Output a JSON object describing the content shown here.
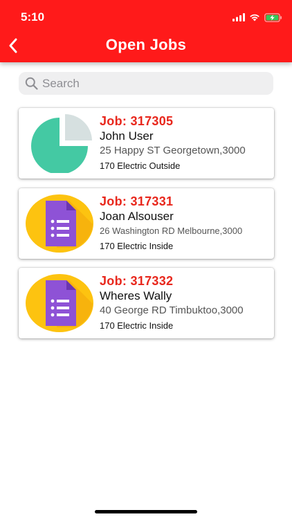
{
  "status_bar": {
    "time": "5:10",
    "icons": [
      "signal-icon",
      "wifi-icon",
      "battery-charging-icon"
    ]
  },
  "header": {
    "title": "Open Jobs",
    "back_icon": "chevron-left-icon"
  },
  "colors": {
    "header_bg": "#ff1a1a",
    "job_id": "#e8271c",
    "search_bg": "#efeff0",
    "pie_fill": "#44c9a3",
    "pie_slice": "#d6e0e0",
    "doc_circle": "#fdc310",
    "doc_icon": "#8e52d6"
  },
  "search": {
    "placeholder": "Search",
    "value": ""
  },
  "jobs": [
    {
      "job_label": "Job: 317305",
      "customer": "John User",
      "address": "25 Happy ST Georgetown,3000",
      "job_type": "170 Electric Outside",
      "icon": "pie-chart-icon"
    },
    {
      "job_label": "Job: 317331",
      "customer": "Joan Alsouser",
      "address": "26 Washington RD Melbourne,3000",
      "job_type": "170 Electric Inside",
      "icon": "form-document-icon"
    },
    {
      "job_label": "Job: 317332",
      "customer": "Wheres Wally",
      "address": "40 George RD Timbuktoo,3000",
      "job_type": "170 Electric Inside",
      "icon": "form-document-icon"
    }
  ]
}
